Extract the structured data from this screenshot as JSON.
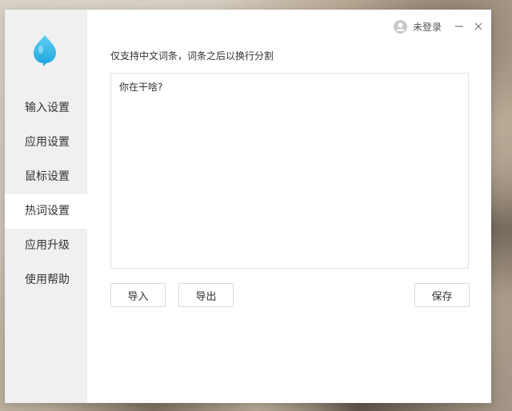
{
  "sidebar": {
    "logo_icon": "blue-drop-logo-icon",
    "items": [
      {
        "label": "输入设置",
        "active": false
      },
      {
        "label": "应用设置",
        "active": false
      },
      {
        "label": "鼠标设置",
        "active": false
      },
      {
        "label": "热词设置",
        "active": true
      },
      {
        "label": "应用升级",
        "active": false
      },
      {
        "label": "使用帮助",
        "active": false
      }
    ]
  },
  "titlebar": {
    "login_label": "未登录",
    "avatar_icon": "user-avatar-icon",
    "minimize_icon": "minimize-icon",
    "close_icon": "close-icon"
  },
  "main": {
    "hint": "仅支持中文词条，词条之后以换行分割",
    "editor_value": "你在干啥?",
    "import_label": "导入",
    "export_label": "导出",
    "save_label": "保存"
  },
  "colors": {
    "accent": "#3db8e8",
    "sidebar_bg": "#f0f0f0",
    "text": "#333333"
  }
}
